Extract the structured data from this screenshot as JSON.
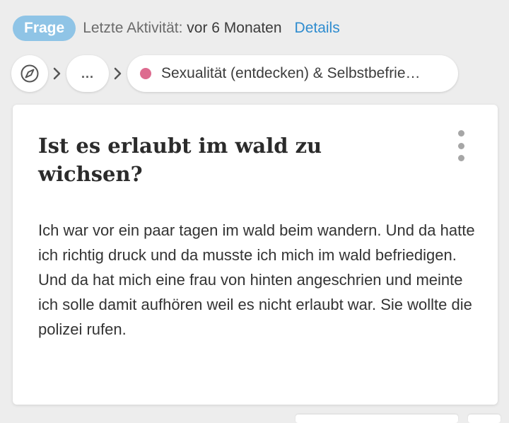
{
  "meta": {
    "badge_label": "Frage",
    "activity_prefix": "Letzte Aktivität:",
    "activity_time": "vor 6 Monaten",
    "details_link": "Details"
  },
  "breadcrumb": {
    "home_icon": "compass-icon",
    "more_label": "...",
    "topic_label": "Sexualität (entdecken) & Selbstbefrie…",
    "topic_color": "#dd6b8f"
  },
  "question": {
    "title": "Ist es erlaubt im wald zu wichsen?",
    "body": "Ich war vor ein paar tagen im wald beim wandern. Und da hatte ich richtig druck und da musste ich mich im wald befriedigen. Und da hat mich eine frau von hinten angeschrien und meinte ich solle damit aufhören weil es nicht erlaubt war. Sie wollte die polizei rufen."
  },
  "colors": {
    "badge_bg": "#8fc4e6",
    "link": "#2e8ccf",
    "page_bg": "#ededed"
  }
}
